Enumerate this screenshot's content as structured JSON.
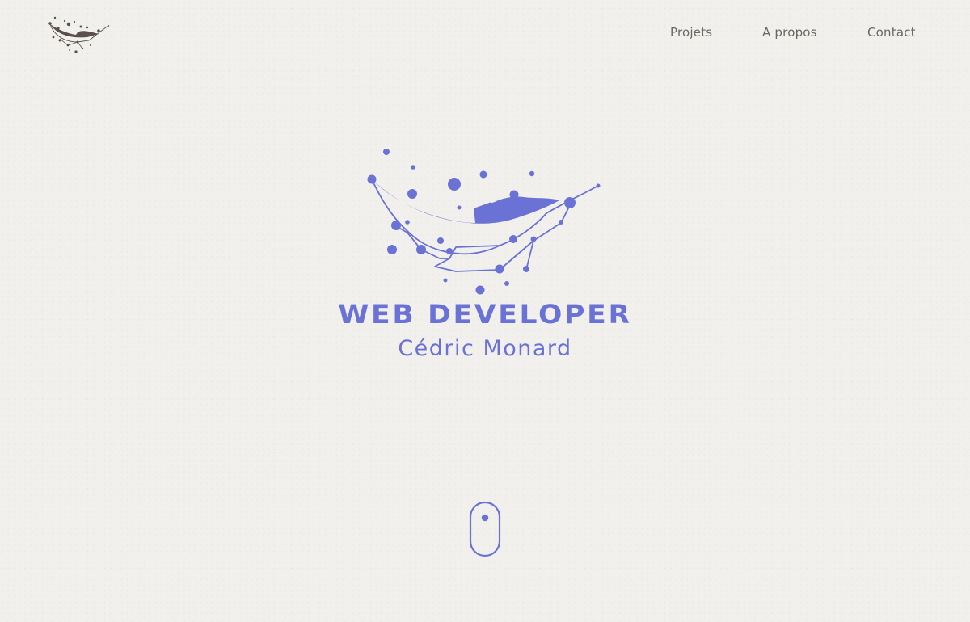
{
  "header": {
    "logo_icon": "whale-constellation-logo-icon",
    "nav": {
      "projects": "Projets",
      "about": "A propos",
      "contact": "Contact"
    }
  },
  "hero": {
    "emblem_icon": "whale-constellation-icon",
    "title": "WEB DEVELOPER",
    "subtitle": "Cédric Monard"
  },
  "scroll_indicator": {
    "icon": "mouse-scroll-icon"
  },
  "colors": {
    "background": "#f2f0ec",
    "accent": "#6b72d6",
    "nav_text": "#6b6862",
    "logo": "#5a4f4c"
  }
}
